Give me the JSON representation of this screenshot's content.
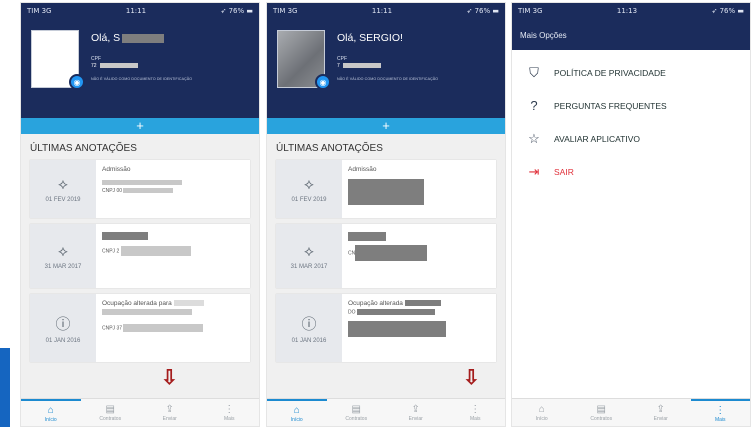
{
  "screens": [
    {
      "status": {
        "carrier": "TIM 3G",
        "time": "11:11",
        "battery": "76%"
      },
      "greeting": "Olá, S",
      "cpf_label": "CPF",
      "cpf_value": "72",
      "disclaimer": "NÃO É VÁLIDO COMO DOCUMENTO DE IDENTIFICAÇÃO",
      "add": "+",
      "section": "ÚLTIMAS ANOTAÇÕES",
      "cards": [
        {
          "date": "01 FEV 2019",
          "title": "Admissão",
          "line": "CNPJ 00"
        },
        {
          "date": "31 MAR 2017",
          "title": "",
          "line": "CNPJ 2"
        },
        {
          "date": "01 JAN 2016",
          "title": "Ocupação alterada para",
          "line": "CNPJ 37"
        }
      ],
      "tabs": [
        "Início",
        "Contratos",
        "Enviar",
        "Mais"
      ]
    },
    {
      "status": {
        "carrier": "TIM 3G",
        "time": "11:11",
        "battery": "76%"
      },
      "greeting": "Olá, SERGIO!",
      "cpf_label": "CPF",
      "cpf_value": "7",
      "disclaimer": "NÃO É VÁLIDO COMO DOCUMENTO DE IDENTIFICAÇÃO",
      "add": "+",
      "section": "ÚLTIMAS ANOTAÇÕES",
      "cards": [
        {
          "date": "01 FEV 2019",
          "title": "Admissão",
          "line": ""
        },
        {
          "date": "31 MAR 2017",
          "title": "",
          "line": "CN"
        },
        {
          "date": "01 JAN 2016",
          "title": "Ocupação alterada",
          "line": "DO"
        }
      ],
      "tabs": [
        "Início",
        "Contratos",
        "Enviar",
        "Mais"
      ]
    },
    {
      "status": {
        "carrier": "TIM 3G",
        "time": "11:13",
        "battery": "76%"
      },
      "title": "Mais Opções",
      "menu": [
        {
          "icon": "shield-icon",
          "label": "POLÍTICA DE PRIVACIDADE"
        },
        {
          "icon": "question-icon",
          "label": "PERGUNTAS FREQUENTES"
        },
        {
          "icon": "star-icon",
          "label": "AVALIAR APLICATIVO"
        },
        {
          "icon": "logout-icon",
          "label": "SAIR",
          "color": "#e0303a"
        }
      ],
      "tabs": [
        "Início",
        "Contratos",
        "Enviar",
        "Mais"
      ]
    }
  ],
  "colors": {
    "header": "#1b2c5c",
    "accent": "#29a3dd",
    "active_tab": "#1c8ad0",
    "arrow": "#a51d1d",
    "danger": "#e0303a"
  }
}
